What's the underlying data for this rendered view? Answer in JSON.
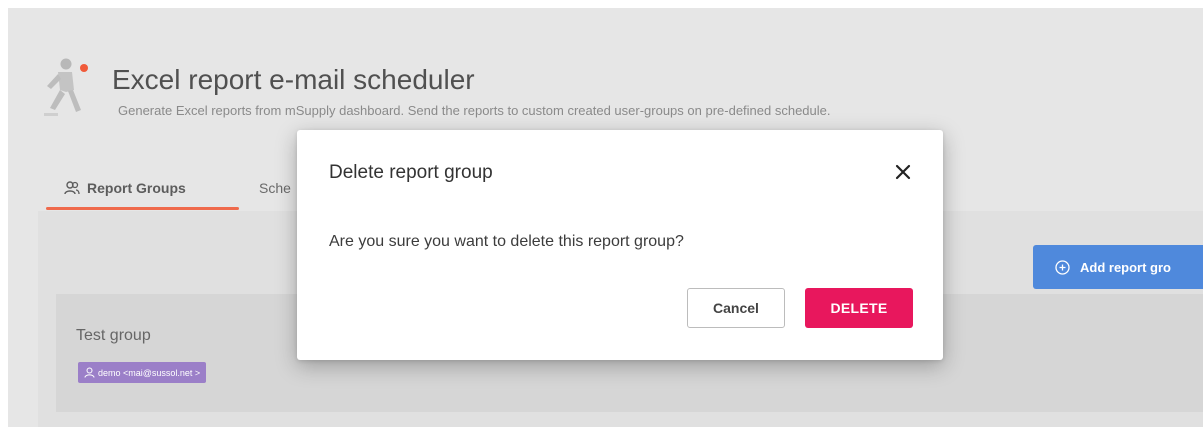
{
  "header": {
    "title": "Excel report e-mail scheduler",
    "subtitle": "Generate Excel reports from mSupply dashboard. Send the reports to custom created user-groups on pre-defined schedule.",
    "logo_icon": "running-figure-icon"
  },
  "tabs": [
    {
      "label": "Report Groups",
      "icon": "users-icon",
      "active": true
    },
    {
      "label": "Sche",
      "active": false
    }
  ],
  "toolbar": {
    "add_label": "Add report gro",
    "add_icon": "add-circle-icon"
  },
  "groups": [
    {
      "name": "Test group",
      "members": [
        {
          "label": "demo <mai@sussol.net >",
          "icon": "user-icon"
        }
      ]
    }
  ],
  "dialog": {
    "title": "Delete report group",
    "message": "Are you sure you want to delete this report group?",
    "cancel_label": "Cancel",
    "delete_label": "DELETE",
    "close_icon": "close-icon"
  },
  "colors": {
    "accent_tab": "#ef6a4c",
    "primary_button": "#4f89dc",
    "delete_button": "#e8175d",
    "chip": "#9b7fc8"
  }
}
